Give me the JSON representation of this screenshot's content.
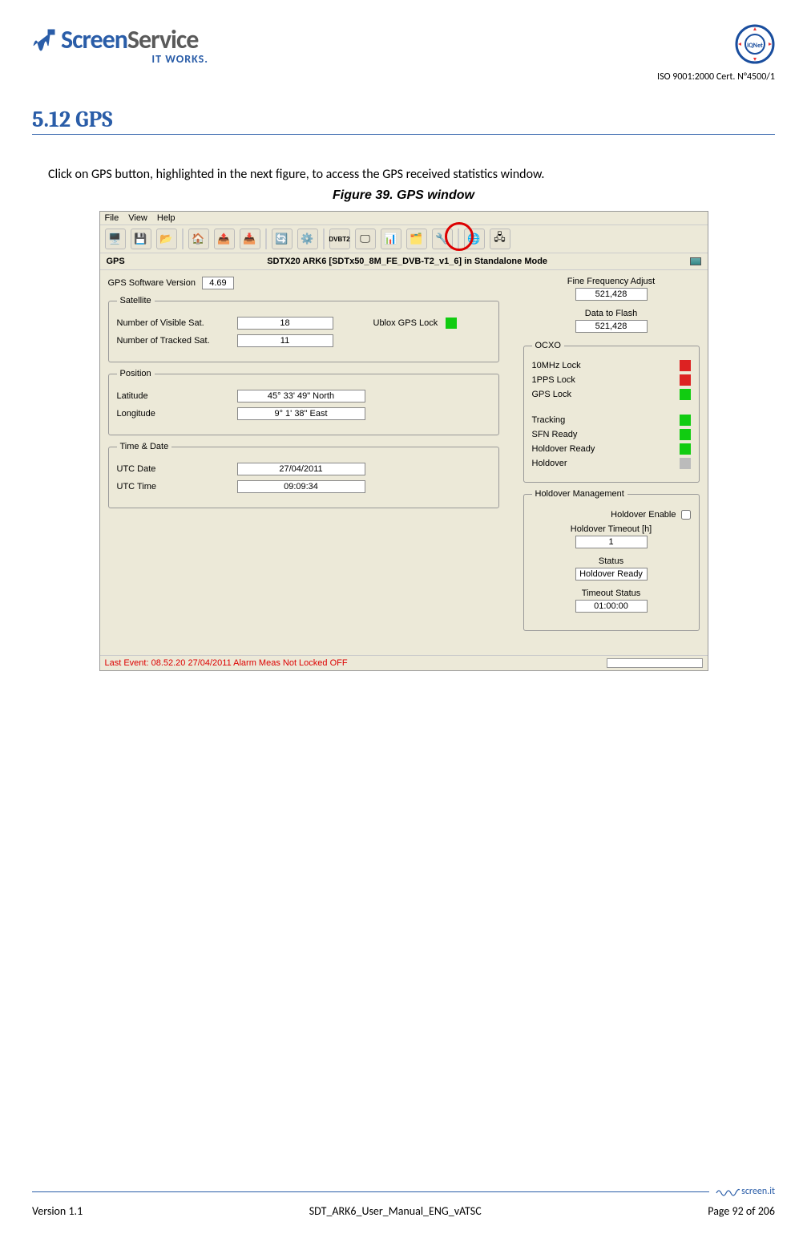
{
  "header": {
    "brand_screen": "Screen",
    "brand_service": "Service",
    "it_works": "IT WORKS.",
    "iso_text": "ISO 9001:2000 Cert. N°4500/1"
  },
  "section_title": "5.12 GPS",
  "intro_text": "Click on GPS button, highlighted in the next figure, to access the GPS received statistics window.",
  "figure_caption": "Figure 39.     GPS window",
  "app": {
    "menu": {
      "file": "File",
      "view": "View",
      "help": "Help"
    },
    "title_left": "GPS",
    "title_center": "SDTX20 ARK6 [SDTx50_8M_FE_DVB-T2_v1_6] in Standalone Mode",
    "version_label": "GPS Software Version",
    "version_value": "4.69",
    "satellite_legend": "Satellite",
    "visible_label": "Number of Visible Sat.",
    "visible_value": "18",
    "tracked_label": "Number of Tracked Sat.",
    "tracked_value": "11",
    "ublox_label": "Ublox GPS Lock",
    "position_legend": "Position",
    "lat_label": "Latitude",
    "lat_value": "45° 33' 49\"  North",
    "lon_label": "Longitude",
    "lon_value": "9° 1' 38\"  East",
    "timedate_legend": "Time & Date",
    "utc_date_label": "UTC Date",
    "utc_date_value": "27/04/2011",
    "utc_time_label": "UTC Time",
    "utc_time_value": "09:09:34",
    "fine_freq_label": "Fine Frequency Adjust",
    "fine_freq_value": "521,428",
    "data_flash_label": "Data to Flash",
    "data_flash_value": "521,428",
    "ocxo_legend": "OCXO",
    "ocxo": {
      "mhz10": "10MHz Lock",
      "pps1": "1PPS Lock",
      "gps": "GPS Lock",
      "tracking": "Tracking",
      "sfn": "SFN Ready",
      "holdover_ready": "Holdover Ready",
      "holdover": "Holdover"
    },
    "holdover_mgmt_legend": "Holdover Management",
    "holdover_enable_label": "Holdover Enable",
    "holdover_timeout_label": "Holdover Timeout [h]",
    "holdover_timeout_value": "1",
    "status_label": "Status",
    "status_value": "Holdover Ready",
    "timeout_status_label": "Timeout Status",
    "timeout_status_value": "01:00:00",
    "statusbar_text": "Last Event: 08.52.20 27/04/2011 Alarm  Meas Not Locked OFF"
  },
  "footer": {
    "version": "Version 1.1",
    "doc": "SDT_ARK6_User_Manual_ENG_vATSC",
    "page": "Page 92 of 206",
    "logo_text": "screen.it"
  }
}
